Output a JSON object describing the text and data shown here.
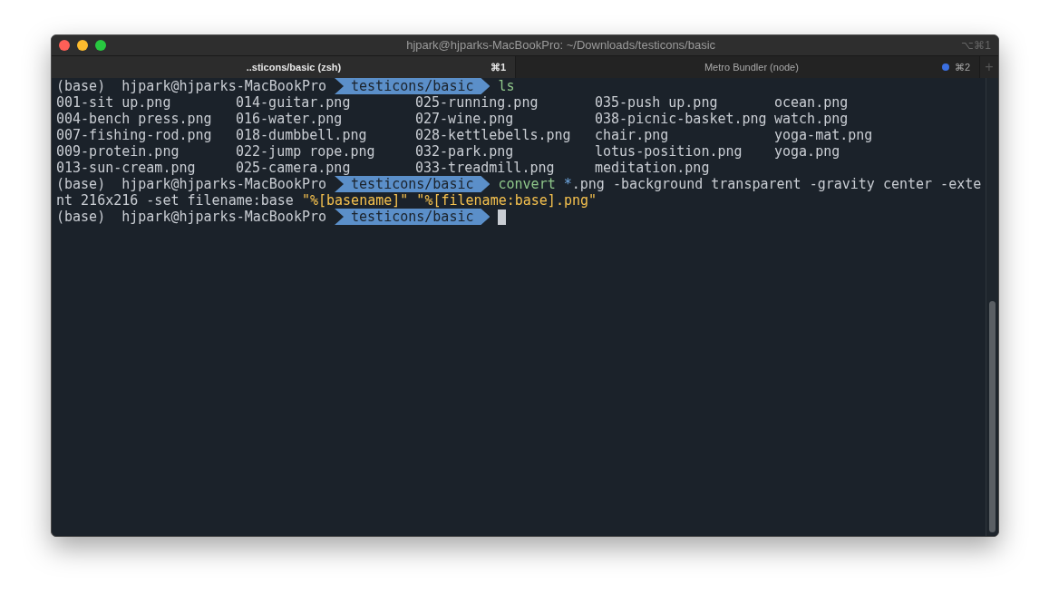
{
  "window": {
    "title": "hjpark@hjparks-MacBookPro: ~/Downloads/testicons/basic",
    "shortcut": "⌥⌘1"
  },
  "tabs": [
    {
      "label": "..sticons/basic (zsh)",
      "shortcut": "⌘1",
      "selected": true,
      "activity": false
    },
    {
      "label": "Metro Bundler (node)",
      "shortcut": "⌘2",
      "selected": false,
      "activity": true
    }
  ],
  "new_tab": "+",
  "terminal": {
    "blocks": [
      {
        "kind": "line",
        "segments": [
          {
            "kind": "text",
            "text": "(base)  hjpark@hjparks-MacBookPro"
          },
          {
            "kind": "path",
            "text": "testicons/basic"
          },
          {
            "kind": "command",
            "text": "ls"
          }
        ]
      },
      {
        "kind": "listing",
        "rows": [
          [
            "001-sit up.png",
            "014-guitar.png",
            "025-running.png",
            "035-push up.png",
            "ocean.png"
          ],
          [
            "004-bench press.png",
            "016-water.png",
            "027-wine.png",
            "038-picnic-basket.png",
            "watch.png"
          ],
          [
            "007-fishing-rod.png",
            "018-dumbbell.png",
            "028-kettlebells.png",
            "chair.png",
            "yoga-mat.png"
          ],
          [
            "009-protein.png",
            "022-jump rope.png",
            "032-park.png",
            "lotus-position.png",
            "yoga.png"
          ],
          [
            "013-sun-cream.png",
            "025-camera.png",
            "033-treadmill.png",
            "meditation.png"
          ]
        ]
      },
      {
        "kind": "line",
        "segments": [
          {
            "kind": "text",
            "text": "(base)  hjpark@hjparks-MacBookPro"
          },
          {
            "kind": "path",
            "text": "testicons/basic"
          },
          {
            "kind": "command",
            "text": "convert"
          },
          {
            "kind": "glob",
            "text": "*"
          },
          {
            "kind": "text",
            "text": ".png -background transparent -gravity center -exte"
          }
        ]
      },
      {
        "kind": "line",
        "segments": [
          {
            "kind": "text",
            "text": "nt 216x216 -set filename:base "
          },
          {
            "kind": "string",
            "text": "\"%[basename]\" \"%[filename:base].png\""
          }
        ]
      },
      {
        "kind": "line",
        "segments": [
          {
            "kind": "text",
            "text": "(base)  hjpark@hjparks-MacBookPro"
          },
          {
            "kind": "path",
            "text": "testicons/basic"
          },
          {
            "kind": "cursor"
          }
        ]
      }
    ]
  }
}
